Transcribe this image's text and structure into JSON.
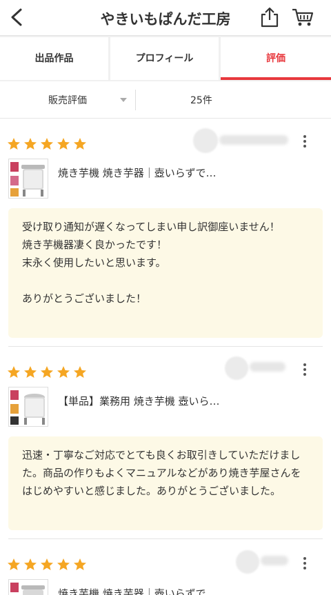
{
  "header": {
    "title": "やきいもぱんだ工房"
  },
  "tabs": [
    {
      "label": "出品作品"
    },
    {
      "label": "プロフィール"
    },
    {
      "label": "評価"
    }
  ],
  "filter": {
    "selected": "販売評価",
    "count": "25件"
  },
  "reviews": [
    {
      "rating": 5,
      "item_title": "焼き芋機 焼き芋器｜壺いらずで…",
      "comment": "受け取り通知が遅くなってしまい申し訳御座いません！\n焼き芋機器凄く良かったです！\n末永く使用したいと思います。\n\nありがとうございました！"
    },
    {
      "rating": 5,
      "item_title": "【単品】業務用 焼き芋機 壺いら…",
      "comment": "迅速・丁寧なご対応でとても良くお取引きしていただけました。商品の作りもよくマニュアルなどがあり焼き芋屋さんをはじめやすいと感じました。ありがとうございました。"
    },
    {
      "rating": 5,
      "item_title": "焼き芋機 焼き芋器｜壺いらずで…"
    }
  ],
  "colors": {
    "accent": "#e8383d",
    "star": "#f5a623",
    "comment_bg": "#fdf9e6"
  },
  "icons": {
    "back": "chevron-left-icon",
    "share": "share-icon",
    "cart": "cart-icon",
    "star": "star-icon",
    "more": "more-vertical-icon"
  }
}
